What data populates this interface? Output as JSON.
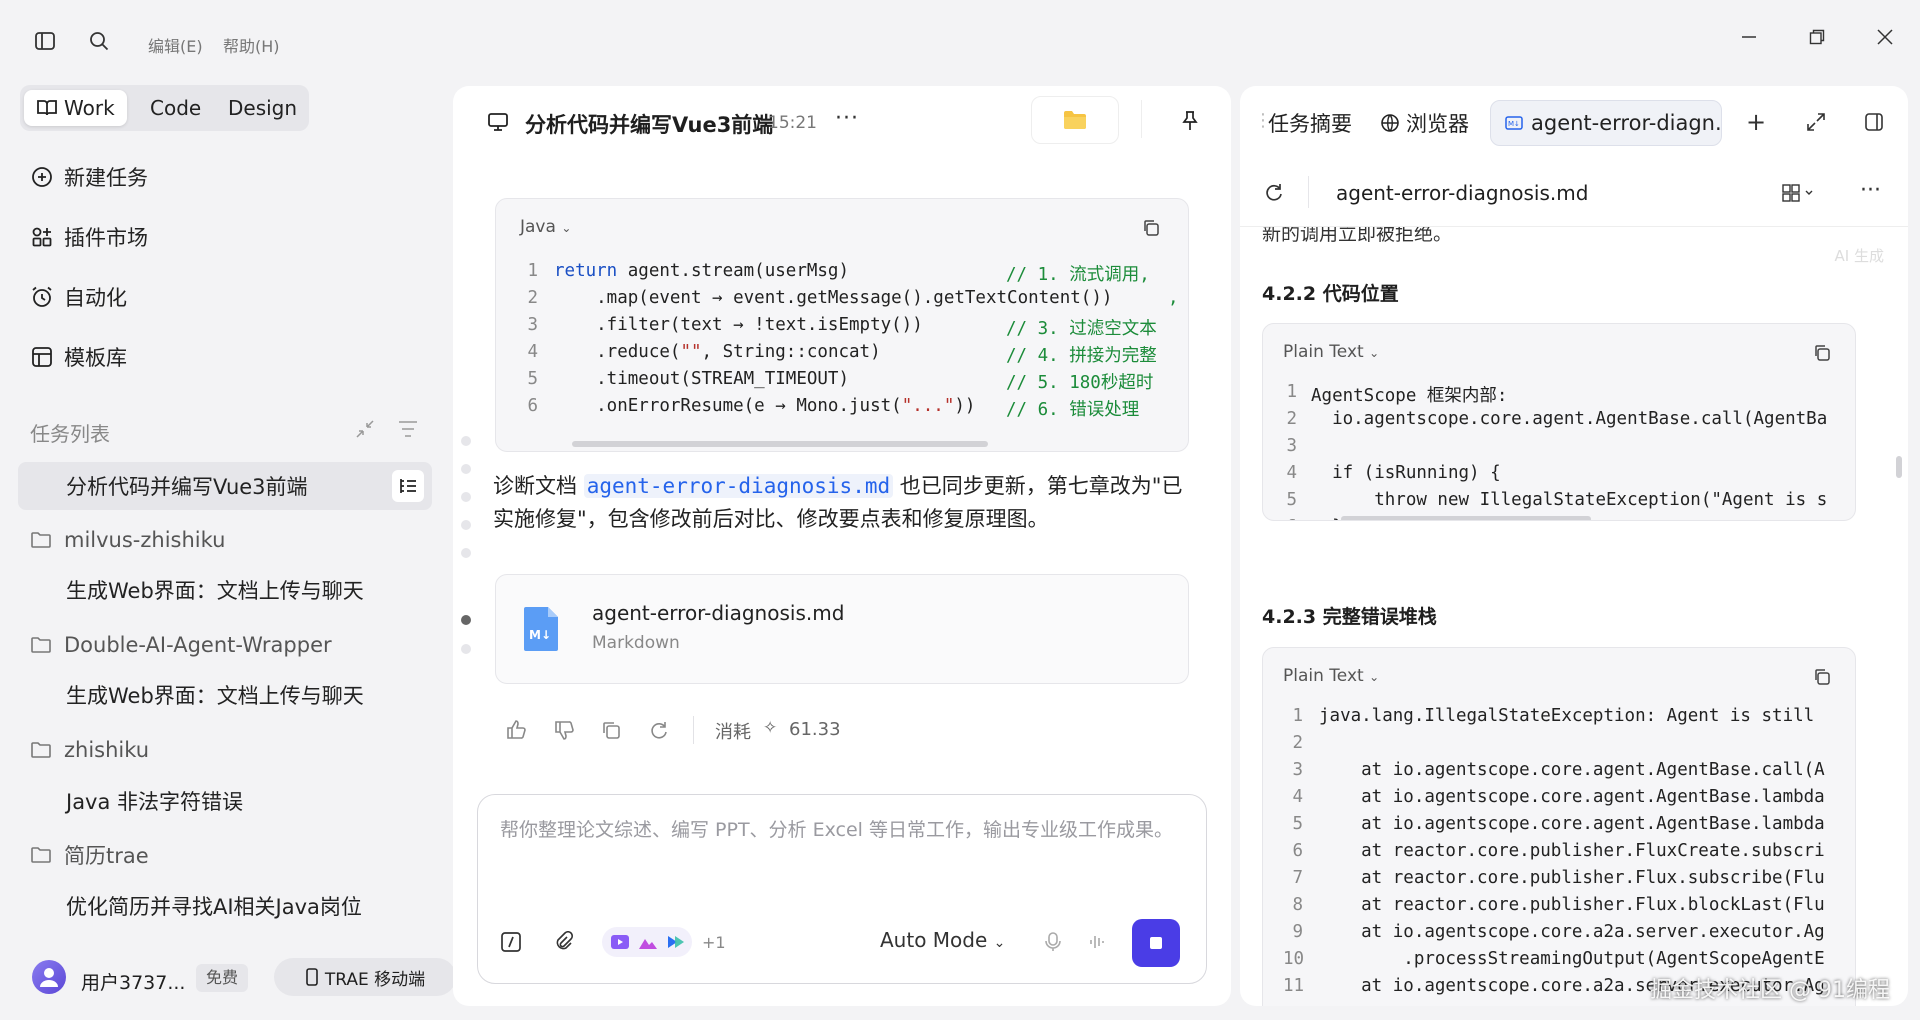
{
  "menu": {
    "edit": "编辑(E)",
    "help": "帮助(H)"
  },
  "modes": [
    "Work",
    "Code",
    "Design"
  ],
  "nav": [
    "新建任务",
    "插件市场",
    "自动化",
    "模板库"
  ],
  "task_list_title": "任务列表",
  "tasks": {
    "active": "分析代码并编写Vue3前端",
    "folders": [
      {
        "name": "milvus-zhishiku",
        "item": "生成Web界面：文档上传与聊天"
      },
      {
        "name": "Double-AI-Agent-Wrapper",
        "item": "生成Web界面：文档上传与聊天"
      },
      {
        "name": "zhishiku",
        "item": "Java 非法字符错误"
      },
      {
        "name": "简历trae",
        "item": "优化简历并寻找AI相关Java岗位"
      }
    ]
  },
  "user": {
    "name": "用户3737...",
    "plan": "免费",
    "mobile": "TRAE 移动端"
  },
  "center": {
    "title": "分析代码并编写Vue3前端",
    "time": "15:21",
    "code": {
      "lang": "Java",
      "lines": [
        {
          "n": "1",
          "code": "return agent.stream(userMsg)",
          "comment": "// 1. 流式调用,"
        },
        {
          "n": "2",
          "code": "    .map(event → event.getMessage().getTextContent())",
          "comment": ","
        },
        {
          "n": "3",
          "code": "    .filter(text → !text.isEmpty())",
          "comment": "// 3. 过滤空文本"
        },
        {
          "n": "4",
          "code": "    .reduce(\"\", String::concat)",
          "comment": "// 4. 拼接为完整"
        },
        {
          "n": "5",
          "code": "    .timeout(STREAM_TIMEOUT)",
          "comment": "// 5. 180秒超时"
        },
        {
          "n": "6",
          "code": "    .onErrorResume(e → Mono.just(\"...\"))",
          "comment": "// 6. 错误处理"
        }
      ]
    },
    "para_prefix": "诊断文档 ",
    "para_link": "agent-error-diagnosis.md",
    "para_line1_rest": " 也已同步更新，第七章改为\"已",
    "para_line2": "实施修复\"，包含修改前后对比、修改要点表和修复原理图。",
    "file_name": "agent-error-diagnosis.md",
    "file_type": "Markdown",
    "usage_label": "消耗",
    "usage_value": "61.33",
    "input_placeholder": "帮你整理论文综述、编写 PPT、分析 Excel 等日常工作，输出专业级工作成果。",
    "plus_count": "+1",
    "mode_select": "Auto Mode"
  },
  "right": {
    "tabs": [
      "任务摘要",
      "浏览器",
      "agent-error-diagn..."
    ],
    "file_path": "agent-error-diagnosis.md",
    "cut_text": "新的调用立即被拒绝。",
    "ai_tag": "AI 生成",
    "h_422": "4.2.2 代码位置",
    "h_423": "4.2.3 完整错误堆栈",
    "code1": {
      "lang": "Plain Text",
      "lines": [
        {
          "n": "1",
          "t": "AgentScope 框架内部:"
        },
        {
          "n": "2",
          "t": "  io.agentscope.core.agent.AgentBase.call(AgentBa"
        },
        {
          "n": "3",
          "t": ""
        },
        {
          "n": "4",
          "t": "  if (isRunning) {"
        },
        {
          "n": "5",
          "t": "      throw new IllegalStateException(\"Agent is s"
        },
        {
          "n": "6",
          "t": "  }"
        }
      ]
    },
    "code2": {
      "lang": "Plain Text",
      "lines": [
        {
          "n": "1",
          "t": "java.lang.IllegalStateException: Agent is still"
        },
        {
          "n": "2",
          "t": ""
        },
        {
          "n": "3",
          "t": "    at io.agentscope.core.agent.AgentBase.call(A"
        },
        {
          "n": "4",
          "t": "    at io.agentscope.core.agent.AgentBase.lambda"
        },
        {
          "n": "5",
          "t": "    at io.agentscope.core.agent.AgentBase.lambda"
        },
        {
          "n": "6",
          "t": "    at reactor.core.publisher.FluxCreate.subscri"
        },
        {
          "n": "7",
          "t": "    at reactor.core.publisher.Flux.subscribe(Flu"
        },
        {
          "n": "8",
          "t": "    at reactor.core.publisher.Flux.blockLast(Flu"
        },
        {
          "n": "9",
          "t": "    at io.agentscope.core.a2a.server.executor.Ag"
        },
        {
          "n": "10",
          "t": "        .processStreamingOutput(AgentScopeAgentE"
        },
        {
          "n": "11",
          "t": "    at io.agentscope.core.a2a.server.executor.Ag"
        }
      ]
    }
  },
  "watermark": "掘金技术社区 @ 91编程"
}
